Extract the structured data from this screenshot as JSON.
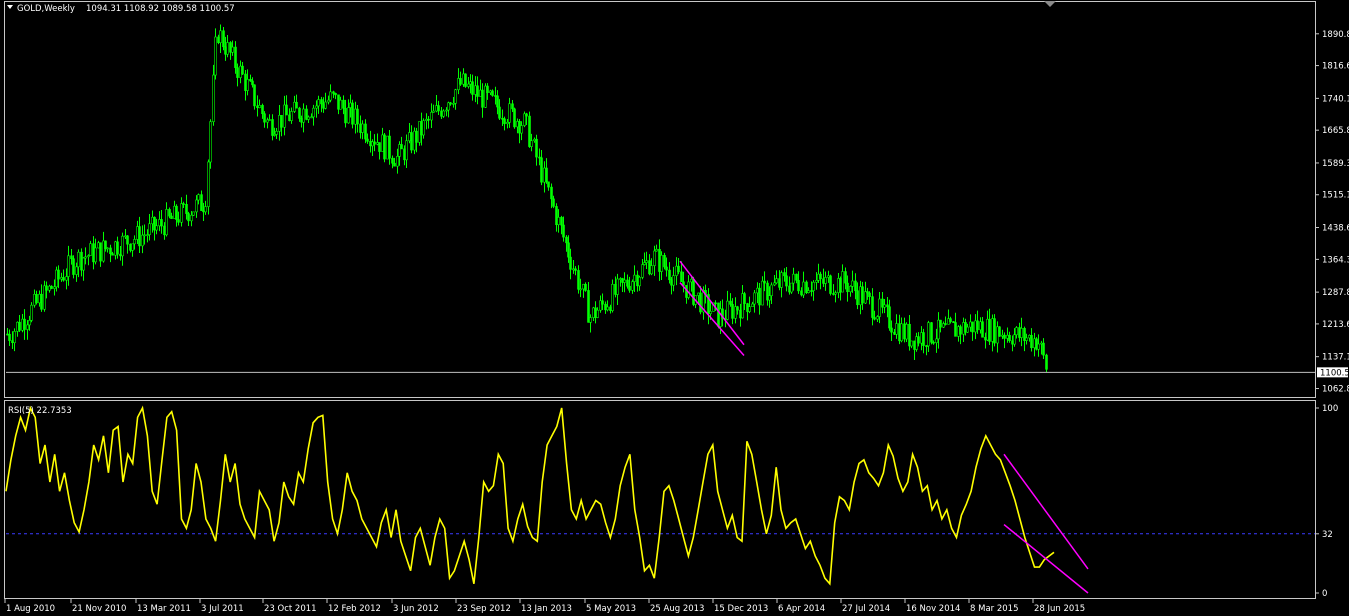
{
  "header": {
    "symbol_label": "GOLD,Weekly",
    "ohlc": "1094.31 1108.92 1089.58 1100.57"
  },
  "indicator": {
    "label": "RSI(5) 22.7353"
  },
  "colors": {
    "background": "#000000",
    "bull_candle": "#00ff00",
    "rsi_line": "#ffff00",
    "trendline": "#ff00ff",
    "level_line": "#3a3aff",
    "frame": "#c8c8c8"
  },
  "chart_data": [
    {
      "type": "candlestick",
      "title": "GOLD,Weekly",
      "ylim": [
        1043,
        1965
      ],
      "y_ticks": [
        1890.8,
        1816.6,
        1740.1,
        1665.8,
        1589.3,
        1515.1,
        1438.6,
        1364.3,
        1287.8,
        1213.6,
        1137.1,
        1062.8
      ],
      "current_price_label": "1100.5",
      "current_price": 1100.57,
      "x_ticks": [
        "1 Aug 2010",
        "21 Nov 2010",
        "13 Mar 2011",
        "3 Jul 2011",
        "23 Oct 2011",
        "12 Feb 2012",
        "3 Jun 2012",
        "23 Sep 2012",
        "13 Jan 2013",
        "5 May 2013",
        "25 Aug 2013",
        "15 Dec 2013",
        "6 Apr 2014",
        "27 Jul 2014",
        "16 Nov 2014",
        "8 Mar 2015",
        "28 Jun 2015"
      ],
      "close_anchors": [
        [
          "1 Aug 2010",
          1190
        ],
        [
          "21 Nov 2010",
          1365
        ],
        [
          "13 Mar 2011",
          1420
        ],
        [
          "3 Jul 2011",
          1500
        ],
        [
          "1 Sep 2011",
          1900
        ],
        [
          "23 Oct 2011",
          1680
        ],
        [
          "12 Feb 2012",
          1740
        ],
        [
          "3 Jun 2012",
          1600
        ],
        [
          "23 Sep 2012",
          1775
        ],
        [
          "13 Jan 2013",
          1680
        ],
        [
          "5 May 2013",
          1230
        ],
        [
          "25 Aug 2013",
          1370
        ],
        [
          "15 Dec 2013",
          1230
        ],
        [
          "6 Apr 2014",
          1310
        ],
        [
          "27 Jul 2014",
          1310
        ],
        [
          "16 Nov 2014",
          1180
        ],
        [
          "8 Mar 2015",
          1210
        ],
        [
          "28 Jun 2015",
          1175
        ],
        [
          "26 Jul 2015",
          1095
        ]
      ],
      "trendlines": [
        {
          "from": [
            "25 Aug 2013",
            1360
          ],
          "to": [
            "15 Dec 2013",
            1165
          ]
        },
        {
          "from": [
            "25 Aug 2013",
            1310
          ],
          "to": [
            "15 Dec 2013",
            1140
          ]
        }
      ]
    },
    {
      "type": "line",
      "title": "RSI(5) 22.7353",
      "ylim": [
        0,
        100
      ],
      "y_ticks": [
        100,
        32,
        0
      ],
      "level": 32,
      "x_ticks": [
        "1 Aug 2010",
        "21 Nov 2010",
        "13 Mar 2011",
        "3 Jul 2011",
        "23 Oct 2011",
        "12 Feb 2012",
        "3 Jun 2012",
        "23 Sep 2012",
        "13 Jan 2013",
        "5 May 2013",
        "25 Aug 2013",
        "15 Dec 2013",
        "6 Apr 2014",
        "27 Jul 2014",
        "16 Nov 2014",
        "8 Mar 2015",
        "28 Jun 2015"
      ],
      "series": [
        {
          "values": [
            55,
            72,
            85,
            95,
            88,
            100,
            95,
            70,
            80,
            60,
            75,
            55,
            65,
            50,
            38,
            33,
            45,
            60,
            80,
            72,
            85,
            65,
            88,
            90,
            60,
            75,
            70,
            95,
            100,
            85,
            55,
            48,
            72,
            95,
            98,
            88,
            40,
            35,
            45,
            70,
            60,
            40,
            35,
            28,
            50,
            75,
            60,
            70,
            48,
            40,
            35,
            30,
            55,
            50,
            45,
            28,
            38,
            60,
            52,
            48,
            65,
            60,
            78,
            92,
            95,
            96,
            60,
            40,
            32,
            45,
            65,
            55,
            50,
            40,
            35,
            30,
            25,
            38,
            45,
            30,
            45,
            28,
            20,
            12,
            30,
            35,
            25,
            15,
            30,
            40,
            35,
            8,
            12,
            20,
            28,
            18,
            5,
            30,
            60,
            55,
            58,
            75,
            70,
            35,
            28,
            40,
            48,
            36,
            30,
            28,
            60,
            80,
            85,
            90,
            100,
            70,
            45,
            40,
            50,
            40,
            45,
            50,
            48,
            38,
            30,
            40,
            58,
            68,
            75,
            45,
            30,
            12,
            15,
            8,
            30,
            55,
            58,
            50,
            40,
            30,
            20,
            30,
            45,
            60,
            75,
            80,
            55,
            45,
            35,
            42,
            30,
            28,
            82,
            75,
            60,
            45,
            32,
            42,
            68,
            45,
            35,
            38,
            40,
            32,
            24,
            28,
            20,
            15,
            8,
            5,
            38,
            52,
            50,
            45,
            60,
            70,
            72,
            65,
            62,
            58,
            65,
            80,
            74,
            62,
            55,
            60,
            75,
            68,
            55,
            58,
            45,
            50,
            40,
            45,
            35,
            30,
            42,
            48,
            55,
            68,
            78,
            85,
            80,
            75,
            72,
            65,
            58,
            50,
            40,
            30,
            22,
            14,
            14,
            18,
            20,
            22
          ]
        }
      ],
      "trendlines": [
        {
          "from": [
            "8 Mar 2015",
            75
          ],
          "to": [
            "28 Jun 2015",
            13
          ]
        },
        {
          "from": [
            "8 Mar 2015",
            37
          ],
          "to": [
            "28 Jun 2015",
            0
          ]
        }
      ]
    }
  ]
}
